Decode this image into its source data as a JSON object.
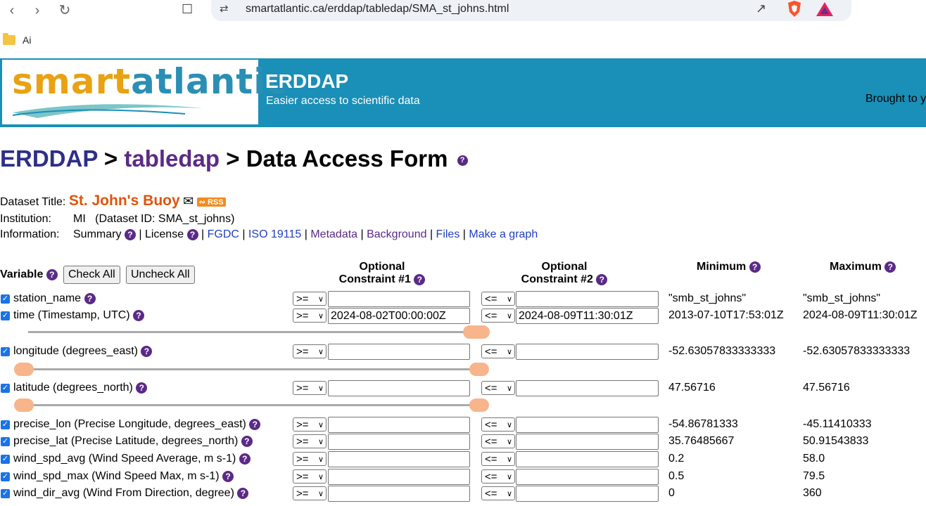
{
  "browser": {
    "url": "smartatlantic.ca/erddap/tabledap/SMA_st_johns.html",
    "bookmark_folder": "Ai"
  },
  "banner": {
    "logo_part1": "smart",
    "logo_part2": "atlantic",
    "title": "ERDDAP",
    "subtitle": "Easier access to scientific data",
    "brought": "Brought to y"
  },
  "heading": {
    "erddap": "ERDDAP",
    "sep1": " > ",
    "tabledap": "tabledap",
    "sep2": " > ",
    "page": "Data Access Form"
  },
  "info": {
    "dataset_title_label": "Dataset Title: ",
    "dataset_title": "St. John's Buoy",
    "rss": "RSS",
    "institution_label": "Institution:",
    "institution": "MI   (Dataset ID: SMA_st_johns)",
    "information_label": "Information:",
    "summary": "Summary",
    "license": "License",
    "links": [
      "FGDC",
      "ISO 19115",
      "Metadata",
      "Background",
      "Files",
      "Make a graph"
    ]
  },
  "table": {
    "variable": "Variable",
    "check_all": "Check All",
    "uncheck_all": "Uncheck All",
    "c1_line1": "Optional",
    "c1_line2": "Constraint #1",
    "c2_line1": "Optional",
    "c2_line2": "Constraint #2",
    "minimum": "Minimum",
    "maximum": "Maximum"
  },
  "rows": [
    {
      "label": "station_name",
      "op1": ">=",
      "v1": "",
      "op2": "<=",
      "v2": "",
      "min": "\"smb_st_johns\"",
      "max": "\"smb_st_johns\""
    },
    {
      "label": "time (Timestamp, UTC)",
      "op1": ">=",
      "v1": "2024-08-02T00:00:00Z",
      "op2": "<=",
      "v2": "2024-08-09T11:30:01Z",
      "min": "2013-07-10T17:53:01Z",
      "max": "2024-08-09T11:30:01Z"
    },
    {
      "label": "longitude (degrees_east)",
      "op1": ">=",
      "v1": "",
      "op2": "<=",
      "v2": "",
      "min": "-52.63057833333333",
      "max": "-52.63057833333333"
    },
    {
      "label": "latitude (degrees_north)",
      "op1": ">=",
      "v1": "",
      "op2": "<=",
      "v2": "",
      "min": "47.56716",
      "max": "47.56716"
    },
    {
      "label": "precise_lon (Precise Longitude, degrees_east)",
      "op1": ">=",
      "v1": "",
      "op2": "<=",
      "v2": "",
      "min": "-54.86781333",
      "max": "-45.11410333"
    },
    {
      "label": "precise_lat (Precise Latitude, degrees_north)",
      "op1": ">=",
      "v1": "",
      "op2": "<=",
      "v2": "",
      "min": "35.76485667",
      "max": "50.91543833"
    },
    {
      "label": "wind_spd_avg (Wind Speed Average, m s-1)",
      "op1": ">=",
      "v1": "",
      "op2": "<=",
      "v2": "",
      "min": "0.2",
      "max": "58.0"
    },
    {
      "label": "wind_spd_max (Wind Speed Max, m s-1)",
      "op1": ">=",
      "v1": "",
      "op2": "<=",
      "v2": "",
      "min": "0.5",
      "max": "79.5"
    },
    {
      "label": "wind_dir_avg (Wind From Direction, degree)",
      "op1": ">=",
      "v1": "",
      "op2": "<=",
      "v2": "",
      "min": "0",
      "max": "360"
    }
  ],
  "colors": {
    "banner": "#1a8fb7",
    "dataset_title": "#e0540c",
    "link": "#1f3fbf",
    "help_icon": "#5b2a86",
    "slider_handle": "#f8b48a"
  }
}
